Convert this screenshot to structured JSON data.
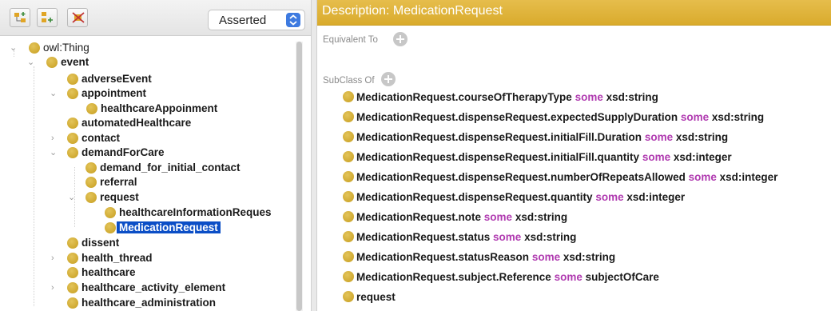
{
  "toolbar": {
    "buttons": [
      "add-subclass-icon",
      "add-sibling-icon",
      "delete-class-icon"
    ],
    "view_mode": "Asserted"
  },
  "tree": {
    "root": "owl:Thing",
    "nodes": [
      {
        "label": "event"
      },
      {
        "label": "adverseEvent"
      },
      {
        "label": "appointment"
      },
      {
        "label": "healthcareAppoinment"
      },
      {
        "label": "automatedHealthcare"
      },
      {
        "label": "contact"
      },
      {
        "label": "demandForCare"
      },
      {
        "label": "demand_for_initial_contact"
      },
      {
        "label": "referral"
      },
      {
        "label": "request"
      },
      {
        "label": "healthcareInformationReques"
      },
      {
        "label": "MedicationRequest"
      },
      {
        "label": "dissent"
      },
      {
        "label": "health_thread"
      },
      {
        "label": "healthcare"
      },
      {
        "label": "healthcare_activity_element"
      },
      {
        "label": "healthcare_administration"
      }
    ]
  },
  "description": {
    "title": "Description: MedicationRequest",
    "equivalent_to_label": "Equivalent To",
    "subclass_of_label": "SubClass Of",
    "axioms": [
      {
        "subject": "MedicationRequest.courseOfTherapyType",
        "keyword": "some",
        "filler": "xsd:string"
      },
      {
        "subject": "MedicationRequest.dispenseRequest.expectedSupplyDuration",
        "keyword": "some",
        "filler": "xsd:string"
      },
      {
        "subject": "MedicationRequest.dispenseRequest.initialFill.Duration",
        "keyword": "some",
        "filler": "xsd:string"
      },
      {
        "subject": "MedicationRequest.dispenseRequest.initialFill.quantity",
        "keyword": "some",
        "filler": "xsd:integer"
      },
      {
        "subject": "MedicationRequest.dispenseRequest.numberOfRepeatsAllowed",
        "keyword": "some",
        "filler": "xsd:integer"
      },
      {
        "subject": "MedicationRequest.dispenseRequest.quantity",
        "keyword": "some",
        "filler": "xsd:integer"
      },
      {
        "subject": "MedicationRequest.note",
        "keyword": "some",
        "filler": "xsd:string"
      },
      {
        "subject": "MedicationRequest.status",
        "keyword": "some",
        "filler": "xsd:string"
      },
      {
        "subject": "MedicationRequest.statusReason",
        "keyword": "some",
        "filler": "xsd:string"
      },
      {
        "subject": "MedicationRequest.subject.Reference",
        "keyword": "some",
        "filler": "subjectOfCare"
      },
      {
        "subject": "request",
        "keyword": "",
        "filler": ""
      }
    ]
  },
  "colors": {
    "header": "#d9ab2c",
    "class_dot": "#d4af37",
    "keyword": "#b03ab0",
    "selection": "#0b4ec6"
  }
}
